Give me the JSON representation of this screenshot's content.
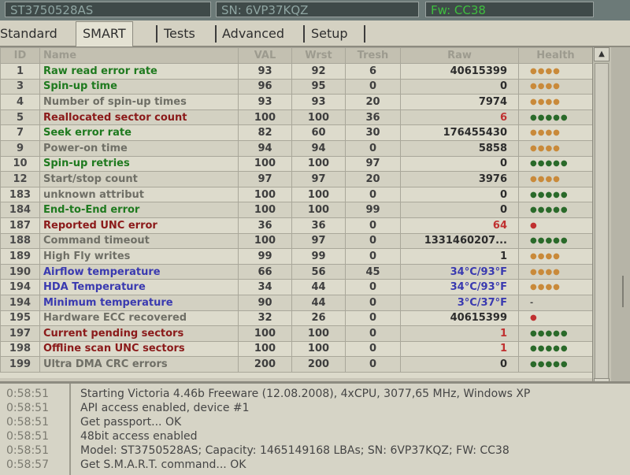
{
  "topbar": {
    "model": "ST3750528AS",
    "serial": "SN: 6VP37KQZ",
    "firmware": "Fw: CC38"
  },
  "tabs": [
    {
      "label": "Standard",
      "active": false
    },
    {
      "label": "SMART",
      "active": true
    },
    {
      "label": "Tests",
      "active": false
    },
    {
      "label": "Advanced",
      "active": false
    },
    {
      "label": "Setup",
      "active": false
    }
  ],
  "table": {
    "columns": [
      "ID",
      "Name",
      "VAL",
      "Wrst",
      "Tresh",
      "Raw",
      "Health"
    ],
    "rows": [
      {
        "id": "1",
        "name": "Raw read error rate",
        "val": "93",
        "wrst": "92",
        "tresh": "6",
        "raw": "40615399",
        "health": "●●●●",
        "name_color": "#1f7a1f",
        "raw_color": "#2c2c2c",
        "health_color": "#c98a3a"
      },
      {
        "id": "3",
        "name": "Spin-up time",
        "val": "96",
        "wrst": "95",
        "tresh": "0",
        "raw": "0",
        "health": "●●●●",
        "name_color": "#1f7a1f",
        "raw_color": "#2c2c2c",
        "health_color": "#c98a3a"
      },
      {
        "id": "4",
        "name": "Number of spin-up times",
        "val": "93",
        "wrst": "93",
        "tresh": "20",
        "raw": "7974",
        "health": "●●●●",
        "name_color": "#6f6f66",
        "raw_color": "#2c2c2c",
        "health_color": "#c98a3a"
      },
      {
        "id": "5",
        "name": "Reallocated sector count",
        "val": "100",
        "wrst": "100",
        "tresh": "36",
        "raw": "6",
        "health": "●●●●●",
        "name_color": "#8b1a1a",
        "raw_color": "#c03030",
        "health_color": "#2a6a2a"
      },
      {
        "id": "7",
        "name": "Seek error rate",
        "val": "82",
        "wrst": "60",
        "tresh": "30",
        "raw": "176455430",
        "health": "●●●●",
        "name_color": "#1f7a1f",
        "raw_color": "#2c2c2c",
        "health_color": "#c98a3a"
      },
      {
        "id": "9",
        "name": "Power-on time",
        "val": "94",
        "wrst": "94",
        "tresh": "0",
        "raw": "5858",
        "health": "●●●●",
        "name_color": "#6f6f66",
        "raw_color": "#2c2c2c",
        "health_color": "#c98a3a"
      },
      {
        "id": "10",
        "name": "Spin-up retries",
        "val": "100",
        "wrst": "100",
        "tresh": "97",
        "raw": "0",
        "health": "●●●●●",
        "name_color": "#1f7a1f",
        "raw_color": "#2c2c2c",
        "health_color": "#2a6a2a"
      },
      {
        "id": "12",
        "name": "Start/stop count",
        "val": "97",
        "wrst": "97",
        "tresh": "20",
        "raw": "3976",
        "health": "●●●●",
        "name_color": "#6f6f66",
        "raw_color": "#2c2c2c",
        "health_color": "#c98a3a"
      },
      {
        "id": "183",
        "name": "unknown attribut",
        "val": "100",
        "wrst": "100",
        "tresh": "0",
        "raw": "0",
        "health": "●●●●●",
        "name_color": "#6f6f66",
        "raw_color": "#2c2c2c",
        "health_color": "#2a6a2a"
      },
      {
        "id": "184",
        "name": "End-to-End error",
        "val": "100",
        "wrst": "100",
        "tresh": "99",
        "raw": "0",
        "health": "●●●●●",
        "name_color": "#1f7a1f",
        "raw_color": "#2c2c2c",
        "health_color": "#2a6a2a"
      },
      {
        "id": "187",
        "name": "Reported UNC error",
        "val": "36",
        "wrst": "36",
        "tresh": "0",
        "raw": "64",
        "health": "●",
        "name_color": "#8b1a1a",
        "raw_color": "#c03030",
        "health_color": "#c03030"
      },
      {
        "id": "188",
        "name": "Command timeout",
        "val": "100",
        "wrst": "97",
        "tresh": "0",
        "raw": "1331460207...",
        "health": "●●●●●",
        "name_color": "#6f6f66",
        "raw_color": "#2c2c2c",
        "health_color": "#2a6a2a"
      },
      {
        "id": "189",
        "name": "High Fly writes",
        "val": "99",
        "wrst": "99",
        "tresh": "0",
        "raw": "1",
        "health": "●●●●",
        "name_color": "#6f6f66",
        "raw_color": "#2c2c2c",
        "health_color": "#c98a3a"
      },
      {
        "id": "190",
        "name": "Airflow temperature",
        "val": "66",
        "wrst": "56",
        "tresh": "45",
        "raw": "34°C/93°F",
        "health": "●●●●",
        "name_color": "#3a3ab0",
        "raw_color": "#3a3ab0",
        "health_color": "#c98a3a"
      },
      {
        "id": "194",
        "name": "HDA Temperature",
        "val": "34",
        "wrst": "44",
        "tresh": "0",
        "raw": "34°C/93°F",
        "health": "●●●●",
        "name_color": "#3a3ab0",
        "raw_color": "#3a3ab0",
        "health_color": "#c98a3a"
      },
      {
        "id": "194",
        "name": "Minimum temperature",
        "val": "90",
        "wrst": "44",
        "tresh": "0",
        "raw": "3°C/37°F",
        "health": "-",
        "name_color": "#3a3ab0",
        "raw_color": "#3a3ab0",
        "health_color": "#3e3e3e"
      },
      {
        "id": "195",
        "name": "Hardware ECC recovered",
        "val": "32",
        "wrst": "26",
        "tresh": "0",
        "raw": "40615399",
        "health": "●",
        "name_color": "#6f6f66",
        "raw_color": "#2c2c2c",
        "health_color": "#c03030"
      },
      {
        "id": "197",
        "name": "Current pending sectors",
        "val": "100",
        "wrst": "100",
        "tresh": "0",
        "raw": "1",
        "health": "●●●●●",
        "name_color": "#8b1a1a",
        "raw_color": "#c03030",
        "health_color": "#2a6a2a"
      },
      {
        "id": "198",
        "name": "Offline scan UNC sectors",
        "val": "100",
        "wrst": "100",
        "tresh": "0",
        "raw": "1",
        "health": "●●●●●",
        "name_color": "#8b1a1a",
        "raw_color": "#c03030",
        "health_color": "#2a6a2a"
      },
      {
        "id": "199",
        "name": "Ultra DMA CRC errors",
        "val": "200",
        "wrst": "200",
        "tresh": "0",
        "raw": "0",
        "health": "●●●●●",
        "name_color": "#6f6f66",
        "raw_color": "#2c2c2c",
        "health_color": "#2a6a2a"
      }
    ]
  },
  "scrollbar": {
    "up_glyph": "▲",
    "down_glyph": "▼"
  },
  "log": [
    {
      "time": "0:58:51",
      "message": "Starting Victoria 4.46b Freeware (12.08.2008), 4xCPU, 3077,65 MHz, Windows XP"
    },
    {
      "time": "0:58:51",
      "message": "API access enabled, device #1"
    },
    {
      "time": "0:58:51",
      "message": "Get passport... OK"
    },
    {
      "time": "0:58:51",
      "message": "48bit access enabled"
    },
    {
      "time": "0:58:51",
      "message": "Model: ST3750528AS; Capacity: 1465149168 LBAs; SN: 6VP37KQZ; FW: CC38"
    },
    {
      "time": "0:58:57",
      "message": "Get S.M.A.R.T. command... OK"
    }
  ]
}
